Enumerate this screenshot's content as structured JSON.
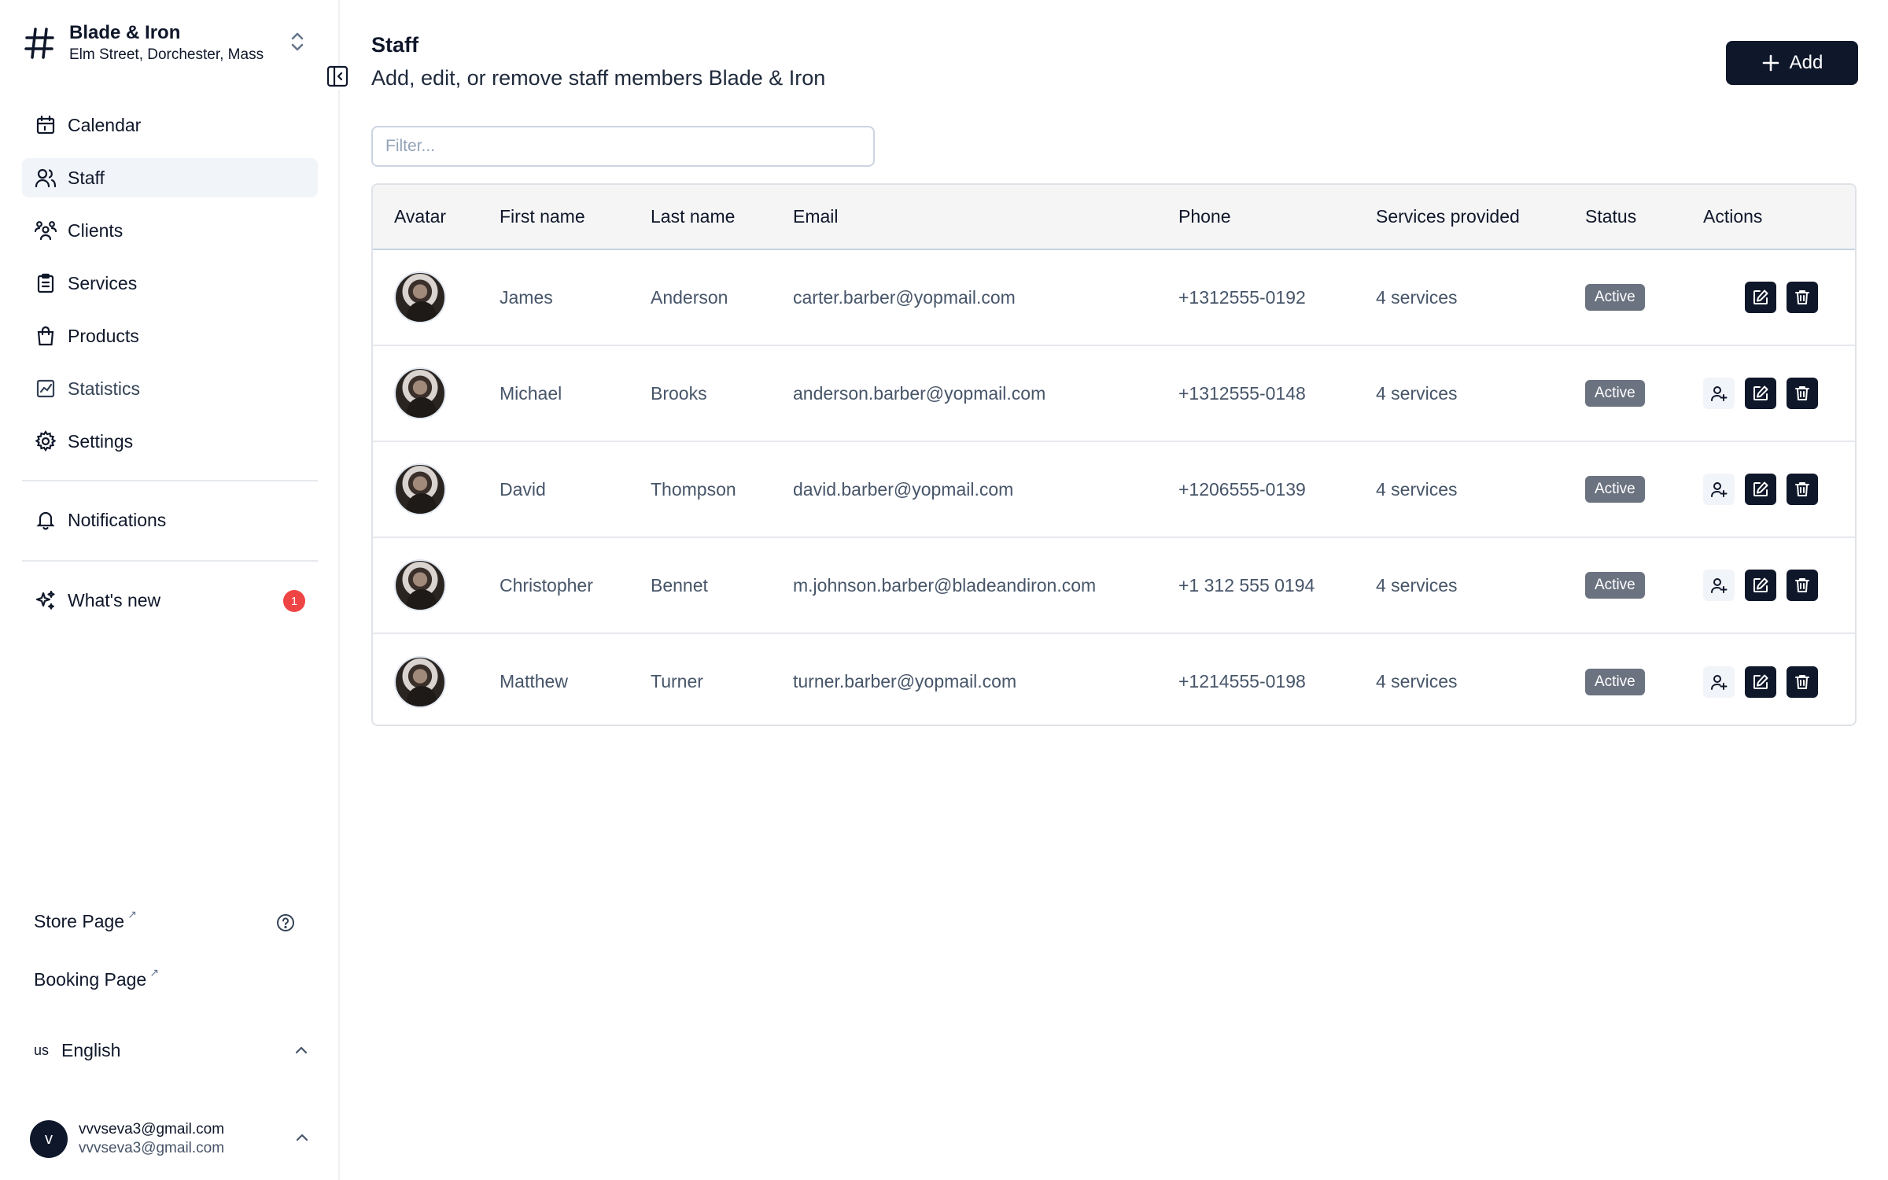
{
  "sidebar": {
    "brand_name": "Blade & Iron",
    "brand_address": "Elm Street, Dorchester, Mass",
    "nav": [
      {
        "label": "Calendar",
        "icon": "calendar-icon"
      },
      {
        "label": "Staff",
        "icon": "users-icon",
        "active": true
      },
      {
        "label": "Clients",
        "icon": "clients-icon"
      },
      {
        "label": "Services",
        "icon": "clipboard-icon"
      },
      {
        "label": "Products",
        "icon": "shopping-bag-icon"
      },
      {
        "label": "Statistics",
        "icon": "chart-icon"
      },
      {
        "label": "Settings",
        "icon": "gear-icon"
      }
    ],
    "notifications_label": "Notifications",
    "whats_new_label": "What's new",
    "whats_new_count": "1",
    "store_page_label": "Store Page",
    "booking_page_label": "Booking Page",
    "language_code": "us",
    "language_label": "English",
    "user_name": "vvvseva3@gmail.com",
    "user_email": "vvvseva3@gmail.com",
    "user_initial": "v"
  },
  "header": {
    "title": "Staff",
    "subtitle": "Add, edit, or remove staff members Blade & Iron",
    "add_label": "Add"
  },
  "filter": {
    "placeholder": "Filter..."
  },
  "table": {
    "columns": [
      "Avatar",
      "First name",
      "Last name",
      "Email",
      "Phone",
      "Services provided",
      "Status",
      "Actions"
    ],
    "rows": [
      {
        "first": "James",
        "last": "Anderson",
        "email": "carter.barber@yopmail.com",
        "phone": "+1312555-0192",
        "services": "4 services",
        "status": "Active",
        "can_add_user": false
      },
      {
        "first": "Michael",
        "last": "Brooks",
        "email": "anderson.barber@yopmail.com",
        "phone": "+1312555-0148",
        "services": "4 services",
        "status": "Active",
        "can_add_user": true
      },
      {
        "first": "David",
        "last": "Thompson",
        "email": "david.barber@yopmail.com",
        "phone": "+1206555-0139",
        "services": "4 services",
        "status": "Active",
        "can_add_user": true
      },
      {
        "first": "Christopher",
        "last": "Bennet",
        "email": "m.johnson.barber@bladeandiron.com",
        "phone": "+1 312 555 0194",
        "services": "4 services",
        "status": "Active",
        "can_add_user": true
      },
      {
        "first": "Matthew",
        "last": "Turner",
        "email": "turner.barber@yopmail.com",
        "phone": "+1214555-0198",
        "services": "4 services",
        "status": "Active",
        "can_add_user": true
      }
    ]
  },
  "colors": {
    "primary": "#0f172a",
    "status_badge": "#6b7280",
    "notification_badge": "#ef4444",
    "active_nav": "#f1f4f8"
  }
}
